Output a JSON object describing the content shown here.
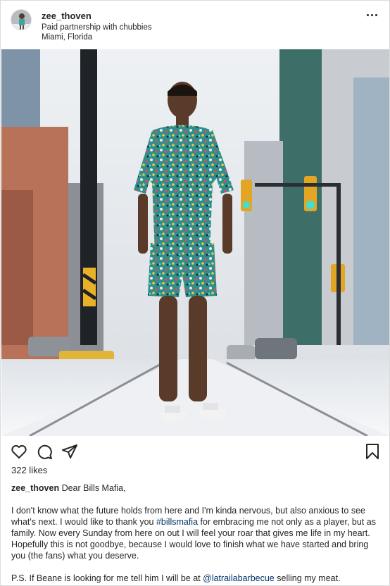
{
  "post": {
    "username": "zee_thoven",
    "sponsor_line": "Paid partnership with chubbies",
    "location": "Miami, Florida",
    "likes_text": "322 likes"
  },
  "caption": {
    "username": "zee_thoven",
    "greeting": "Dear Bills Mafia,",
    "p1_part1": "I don't know what the future holds from here and I'm kinda nervous, but also anxious to see what's next. I would like to thank you ",
    "hashtag": "#billsmafia",
    "p1_part2": " for embracing me not only as a player, but as family. Now every Sunday from here on out I will feel your roar that gives me life in my heart. Hopefully this is not goodbye, because I would love to finish what we have started and bring you (the fans) what you deserve.",
    "p2_part1": "P.S. If Beane is looking for me tell him I will be at ",
    "mention": "@latrailabarbecue",
    "p2_part2": " selling my meat."
  },
  "icons": {
    "more": "more-options-icon",
    "like": "heart-icon",
    "comment": "comment-icon",
    "share": "share-icon",
    "save": "bookmark-icon"
  },
  "colors": {
    "text": "#262626",
    "link": "#003569",
    "border": "#dbdbdb"
  }
}
